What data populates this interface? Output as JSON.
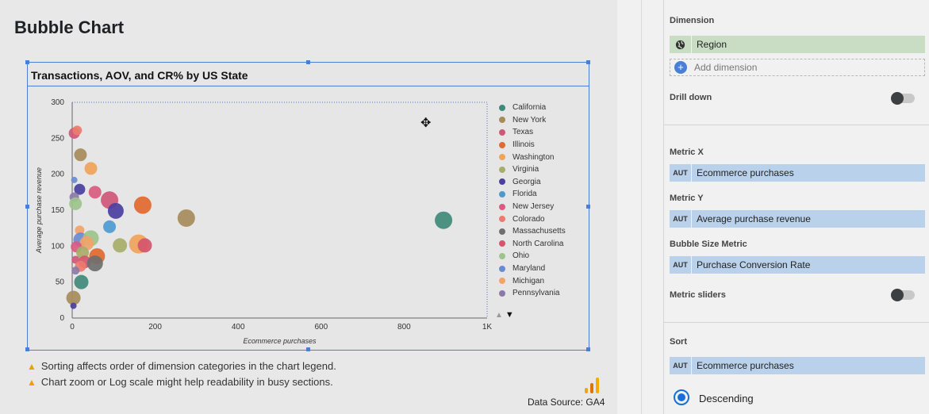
{
  "page": {
    "title": "Bubble Chart"
  },
  "chart": {
    "title": "Transactions, AOV, and CR% by US State",
    "warnings": [
      "Sorting affects order of dimension categories in the chart legend.",
      "Chart zoom or Log scale might help readability in busy sections."
    ],
    "data_source": "Data Source: GA4"
  },
  "chart_data": {
    "type": "scatter",
    "title": "Transactions, AOV, and CR% by US State",
    "xlabel": "Ecommerce purchases",
    "ylabel": "Average purchase revenue",
    "xlim": [
      0,
      1000
    ],
    "ylim": [
      0,
      300
    ],
    "x_ticks": [
      "0",
      "200",
      "400",
      "600",
      "800",
      "1K"
    ],
    "y_ticks": [
      "0",
      "50",
      "100",
      "150",
      "200",
      "250",
      "300"
    ],
    "x_tick_values": [
      0,
      200,
      400,
      600,
      800,
      1000
    ],
    "y_tick_values": [
      0,
      50,
      100,
      150,
      200,
      250,
      300
    ],
    "legend_position": "right",
    "legend": [
      {
        "name": "California",
        "color": "#3f8a78"
      },
      {
        "name": "New York",
        "color": "#a68c5c"
      },
      {
        "name": "Texas",
        "color": "#d0577a"
      },
      {
        "name": "Illinois",
        "color": "#e2692f"
      },
      {
        "name": "Washington",
        "color": "#f0a45a"
      },
      {
        "name": "Virginia",
        "color": "#a7ad6a"
      },
      {
        "name": "Georgia",
        "color": "#4b3fa0"
      },
      {
        "name": "Florida",
        "color": "#4e9ad0"
      },
      {
        "name": "New Jersey",
        "color": "#d95b80"
      },
      {
        "name": "Colorado",
        "color": "#ec7b6e"
      },
      {
        "name": "Massachusetts",
        "color": "#6f6f6f"
      },
      {
        "name": "North Carolina",
        "color": "#d4566c"
      },
      {
        "name": "Ohio",
        "color": "#9dc48b"
      },
      {
        "name": "Maryland",
        "color": "#6b8bd0"
      },
      {
        "name": "Michigan",
        "color": "#f2a36a"
      },
      {
        "name": "Pennsylvania",
        "color": "#8b7aa8"
      }
    ],
    "points": [
      {
        "x": 895,
        "y": 136,
        "size": 11,
        "color": "#3f8a78"
      },
      {
        "x": 275,
        "y": 139,
        "size": 11,
        "color": "#a68c5c"
      },
      {
        "x": 170,
        "y": 157,
        "size": 11,
        "color": "#e2692f"
      },
      {
        "x": 90,
        "y": 164,
        "size": 11,
        "color": "#d0577a"
      },
      {
        "x": 105,
        "y": 149,
        "size": 10,
        "color": "#4b3fa0"
      },
      {
        "x": 55,
        "y": 175,
        "size": 8,
        "color": "#d95b80"
      },
      {
        "x": 90,
        "y": 127,
        "size": 8,
        "color": "#4e9ad0"
      },
      {
        "x": 115,
        "y": 101,
        "size": 9,
        "color": "#a7ad6a"
      },
      {
        "x": 160,
        "y": 103,
        "size": 12,
        "color": "#f0a45a"
      },
      {
        "x": 175,
        "y": 101,
        "size": 9,
        "color": "#d4566c"
      },
      {
        "x": 5,
        "y": 257,
        "size": 7,
        "color": "#d0577a"
      },
      {
        "x": 12,
        "y": 261,
        "size": 6,
        "color": "#ec7b6e"
      },
      {
        "x": 20,
        "y": 227,
        "size": 8,
        "color": "#a68c5c"
      },
      {
        "x": 45,
        "y": 208,
        "size": 8,
        "color": "#f0a45a"
      },
      {
        "x": 5,
        "y": 192,
        "size": 4,
        "color": "#6b8bd0"
      },
      {
        "x": 18,
        "y": 179,
        "size": 7,
        "color": "#4b3fa0"
      },
      {
        "x": 5,
        "y": 168,
        "size": 6,
        "color": "#8b7aa8"
      },
      {
        "x": 8,
        "y": 159,
        "size": 8,
        "color": "#9dc48b"
      },
      {
        "x": 18,
        "y": 122,
        "size": 6,
        "color": "#f2a36a"
      },
      {
        "x": 20,
        "y": 109,
        "size": 9,
        "color": "#6b8bd0"
      },
      {
        "x": 45,
        "y": 111,
        "size": 10,
        "color": "#9dc48b"
      },
      {
        "x": 35,
        "y": 104,
        "size": 9,
        "color": "#f2a36a"
      },
      {
        "x": 10,
        "y": 99,
        "size": 7,
        "color": "#d95b80"
      },
      {
        "x": 25,
        "y": 91,
        "size": 8,
        "color": "#a7ad6a"
      },
      {
        "x": 60,
        "y": 86,
        "size": 10,
        "color": "#e2692f"
      },
      {
        "x": 30,
        "y": 78,
        "size": 8,
        "color": "#d4566c"
      },
      {
        "x": 55,
        "y": 76,
        "size": 10,
        "color": "#6f6f6f"
      },
      {
        "x": 8,
        "y": 81,
        "size": 5,
        "color": "#d0577a"
      },
      {
        "x": 20,
        "y": 72,
        "size": 7,
        "color": "#ec7b6e"
      },
      {
        "x": 8,
        "y": 66,
        "size": 5,
        "color": "#8b7aa8"
      },
      {
        "x": 22,
        "y": 50,
        "size": 9,
        "color": "#3f8a78"
      },
      {
        "x": 3,
        "y": 28,
        "size": 9,
        "color": "#a68c5c"
      },
      {
        "x": 3,
        "y": 17,
        "size": 4,
        "color": "#4b3fa0"
      }
    ]
  },
  "panel": {
    "dimension_label": "Dimension",
    "dimension_value": "Region",
    "add_dimension": "Add dimension",
    "drill_down_label": "Drill down",
    "metric_x_label": "Metric X",
    "metric_x_type": "AUT",
    "metric_x_value": "Ecommerce purchases",
    "metric_y_label": "Metric Y",
    "metric_y_type": "AUT",
    "metric_y_value": "Average purchase revenue",
    "bubble_size_label": "Bubble Size Metric",
    "bubble_size_type": "AUT",
    "bubble_size_value": "Purchase Conversion Rate",
    "metric_sliders_label": "Metric sliders",
    "sort_label": "Sort",
    "sort_type": "AUT",
    "sort_value": "Ecommerce purchases",
    "order_label": "Descending"
  },
  "colors": {
    "accent": "#4a7fd4",
    "dimension_chip": "#c9ddc5",
    "metric_chip": "#b9d1ea",
    "warning": "#e8a400"
  }
}
